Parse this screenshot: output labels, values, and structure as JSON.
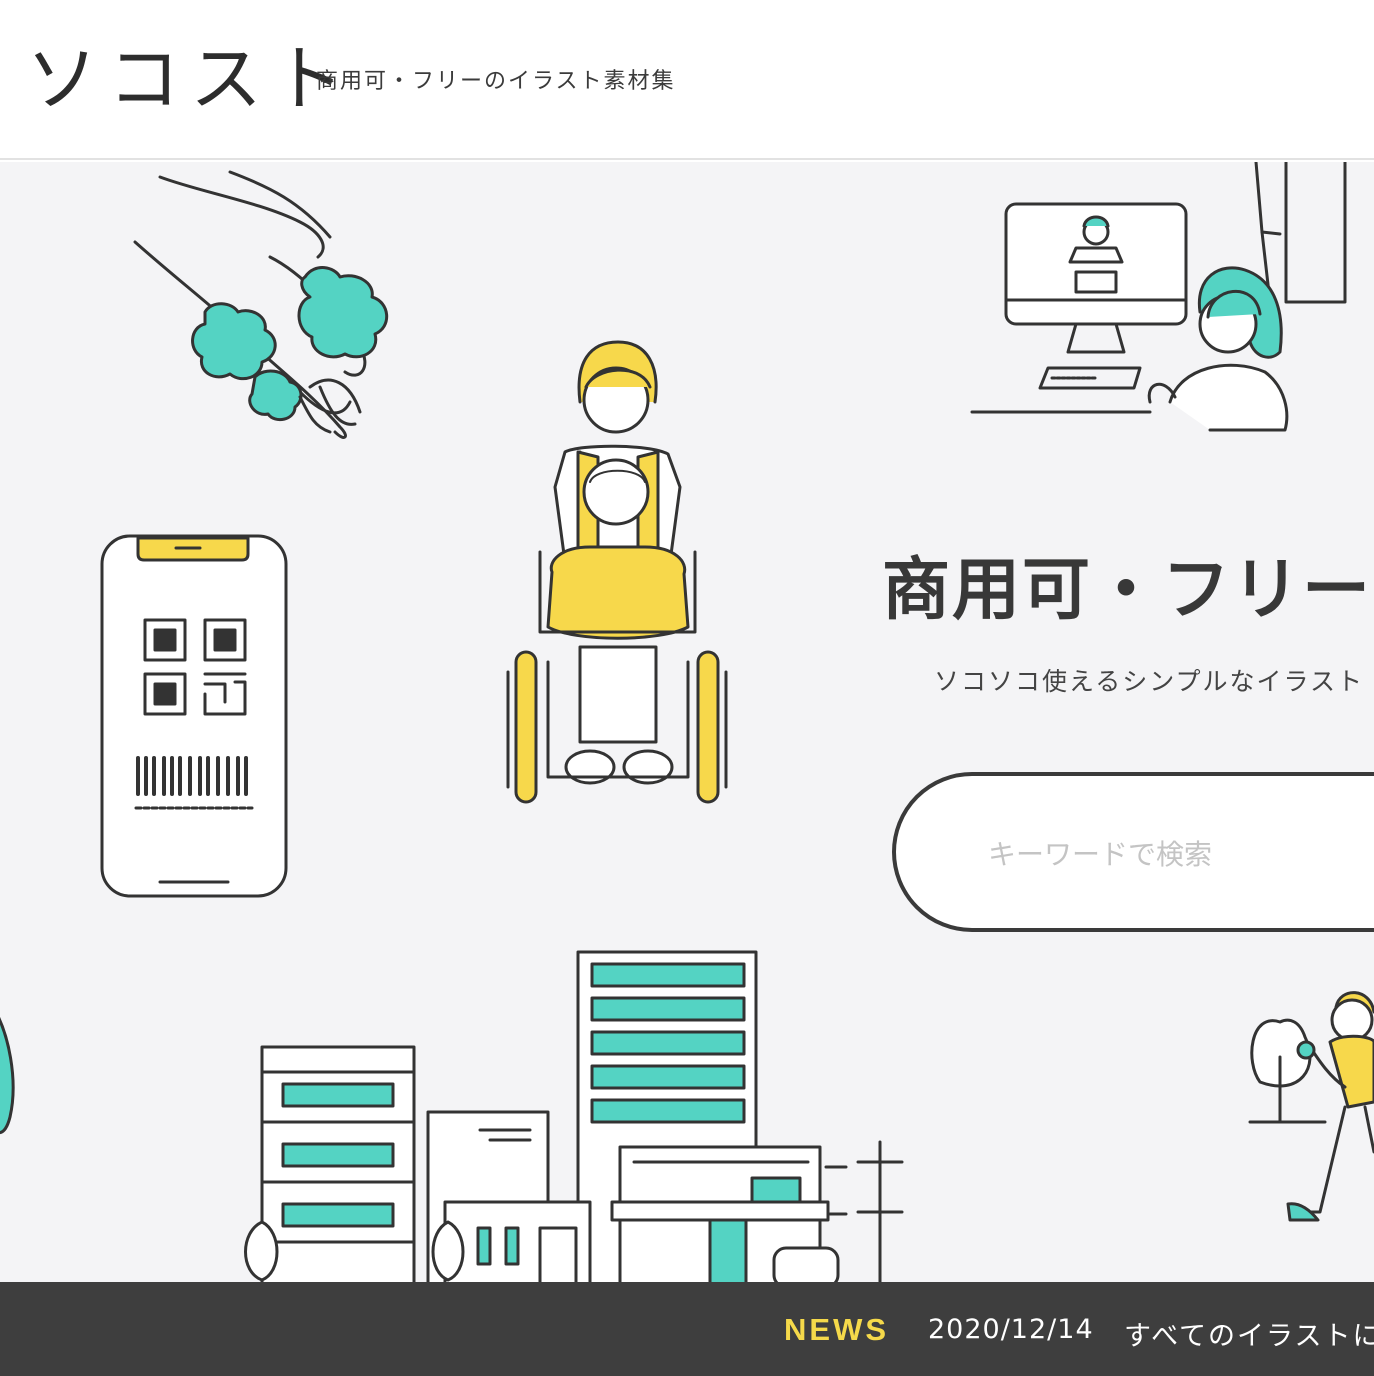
{
  "header": {
    "logo": "ソコスト",
    "tagline": "商用可・フリーのイラスト素材集"
  },
  "hero": {
    "title": "商用可・フリーの",
    "subtitle": "ソコソコ使えるシンプルなイラスト",
    "search": {
      "placeholder": "キーワードで検索",
      "value": ""
    }
  },
  "news": {
    "label": "NEWS",
    "date": "2020/12/14",
    "text": "すべてのイラストに"
  },
  "colors": {
    "accent_teal": "#54d3c3",
    "accent_yellow": "#f7d84b",
    "line": "#333333",
    "hero_bg": "#f4f4f6",
    "news_bg": "#3e3e3e"
  }
}
